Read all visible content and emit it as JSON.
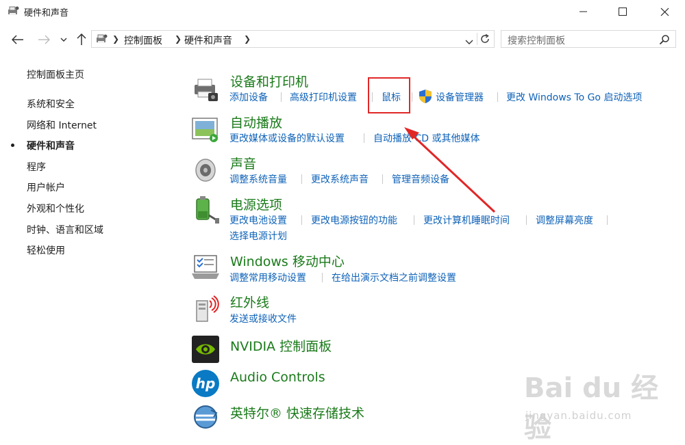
{
  "window": {
    "title": "硬件和声音"
  },
  "address": {
    "crumbs": [
      "控制面板",
      "硬件和声音"
    ]
  },
  "search": {
    "placeholder": "搜索控制面板"
  },
  "left_nav": {
    "items": [
      {
        "label": "控制面板主页"
      },
      {
        "label": "系统和安全"
      },
      {
        "label": "网络和 Internet"
      },
      {
        "label": "硬件和声音",
        "current": true
      },
      {
        "label": "程序"
      },
      {
        "label": "用户帐户"
      },
      {
        "label": "外观和个性化"
      },
      {
        "label": "时钟、语言和区域"
      },
      {
        "label": "轻松使用"
      }
    ]
  },
  "categories": {
    "devices": {
      "title": "设备和打印机",
      "links": [
        "添加设备",
        "高级打印机设置",
        "鼠标",
        "设备管理器",
        "更改 Windows To Go 启动选项"
      ]
    },
    "autoplay": {
      "title": "自动播放",
      "links": [
        "更改媒体或设备的默认设置",
        "自动播放 CD 或其他媒体"
      ]
    },
    "sound": {
      "title": "声音",
      "links": [
        "调整系统音量",
        "更改系统声音",
        "管理音频设备"
      ]
    },
    "power": {
      "title": "电源选项",
      "links": [
        "更改电池设置",
        "更改电源按钮的功能",
        "更改计算机睡眠时间",
        "调整屏幕亮度",
        "选择电源计划"
      ]
    },
    "mobility": {
      "title": "Windows 移动中心",
      "links": [
        "调整常用移动设置",
        "在给出演示文档之前调整设置"
      ]
    },
    "infrared": {
      "title": "红外线",
      "links": [
        "发送或接收文件"
      ]
    },
    "nvidia": {
      "title": "NVIDIA 控制面板"
    },
    "audio": {
      "title": "Audio Controls"
    },
    "intel": {
      "title": "英特尔® 快速存储技术"
    }
  },
  "watermark": {
    "brand": "Bai du 经验",
    "url": "jingyan.baidu.com"
  },
  "colors": {
    "category_title": "#1a7a1a",
    "link": "#0e62b8",
    "highlight": "#e12626"
  }
}
